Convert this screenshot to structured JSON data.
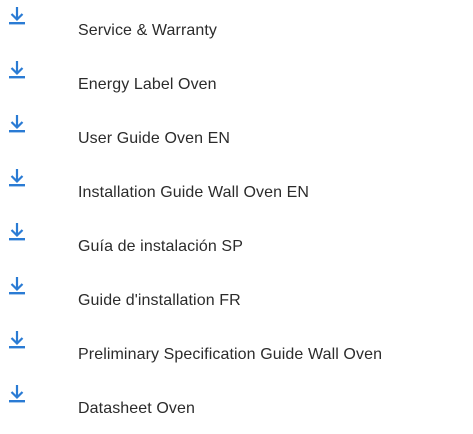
{
  "colors": {
    "icon": "#2a7bd4",
    "text": "#2b2b2b",
    "background": "#ffffff"
  },
  "downloads": {
    "icon_name": "download-icon",
    "items": [
      {
        "label": "Service & Warranty"
      },
      {
        "label": "Energy Label Oven"
      },
      {
        "label": "User Guide Oven EN"
      },
      {
        "label": "Installation Guide Wall Oven EN"
      },
      {
        "label": "Guía de instalación SP"
      },
      {
        "label": "Guide d'installation FR"
      },
      {
        "label": "Preliminary Specification Guide Wall Oven"
      },
      {
        "label": "Datasheet Oven"
      }
    ]
  }
}
